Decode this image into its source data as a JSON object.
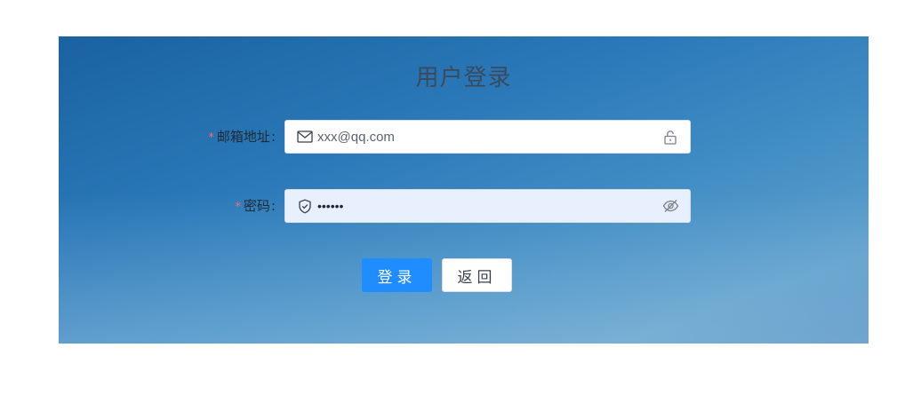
{
  "page": {
    "title": "用户登录"
  },
  "form": {
    "email": {
      "required_mark": "*",
      "label": "邮箱地址",
      "colon": ":",
      "value": "xxx@qq.com",
      "prefix_icon": "mail-icon",
      "suffix_icon": "unlock-icon"
    },
    "password": {
      "required_mark": "*",
      "label": "密码",
      "colon": ":",
      "value": "••••••",
      "prefix_icon": "shield-icon",
      "suffix_icon": "eye-off-icon"
    }
  },
  "actions": {
    "login_label": "登录",
    "back_label": "返回"
  },
  "colors": {
    "primary": "#1f8cff",
    "required": "#f56c6c",
    "panel_top": "#1a62a0",
    "panel_bottom": "#5ea0cc"
  }
}
